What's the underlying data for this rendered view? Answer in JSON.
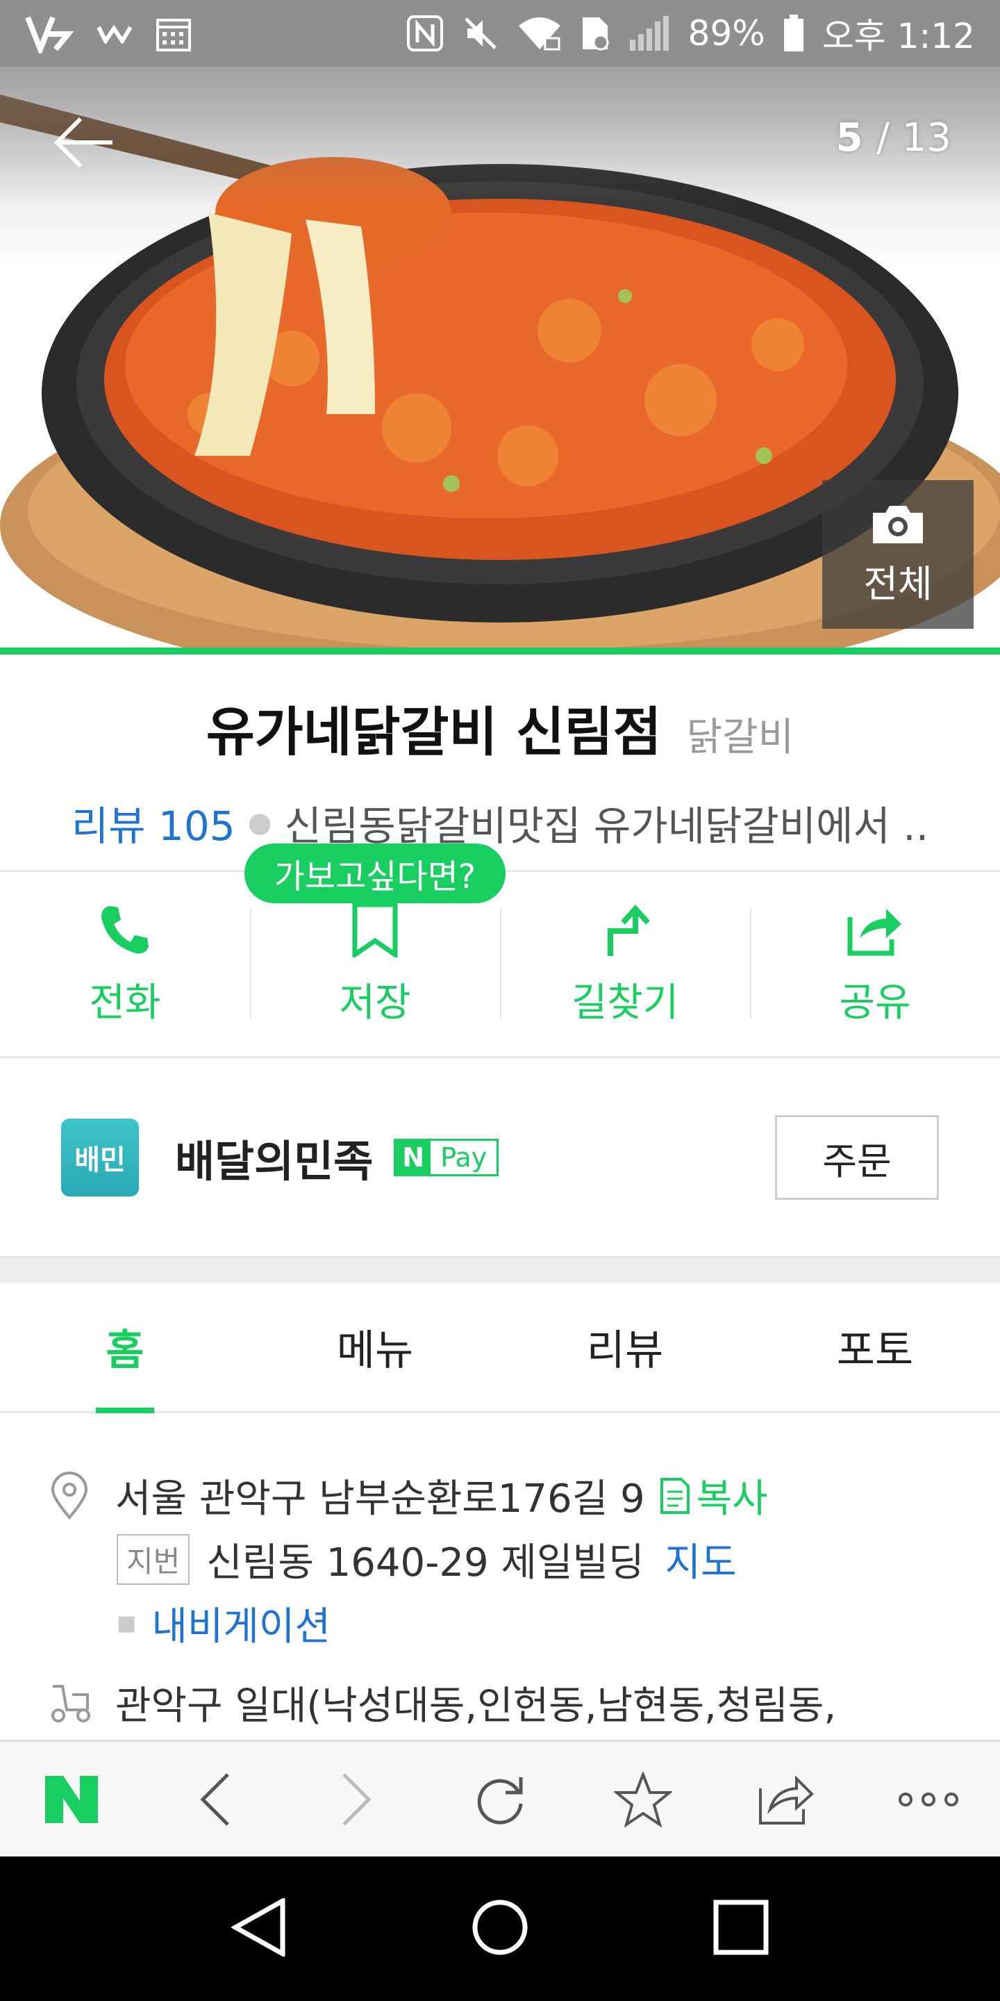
{
  "status_bar": {
    "battery": "89%",
    "time": "오후 1:12",
    "icons": [
      "v3-app-icon",
      "w-app-icon",
      "calendar-icon",
      "nfc-icon",
      "mute-icon",
      "wifi-lock-icon",
      "sim-icon",
      "signal-icon",
      "battery-icon"
    ]
  },
  "hero": {
    "current": "5",
    "total": "/ 13",
    "all_photos_label": "전체",
    "image": "steel-pan-cheese-fried-rice-photo"
  },
  "place": {
    "name": "유가네닭갈비 신림점",
    "category": "닭갈비",
    "review_label": "리뷰 105",
    "description": "신림동닭갈비맛집 유가네닭갈비에서 .."
  },
  "tooltip": "가보고싶다면?",
  "actions": [
    {
      "label": "전화",
      "icon": "phone-icon"
    },
    {
      "label": "저장",
      "icon": "bookmark-icon"
    },
    {
      "label": "길찾기",
      "icon": "directions-icon"
    },
    {
      "label": "공유",
      "icon": "share-icon"
    }
  ],
  "delivery": {
    "app_name": "배달의민족",
    "app_icon_text": "배민",
    "npay_n": "N",
    "npay_pay": "Pay",
    "order_label": "주문"
  },
  "tabs": [
    {
      "label": "홈",
      "active": true
    },
    {
      "label": "메뉴",
      "active": false
    },
    {
      "label": "리뷰",
      "active": false
    },
    {
      "label": "포토",
      "active": false
    }
  ],
  "info": {
    "address": "서울 관악구 남부순환로176길 9",
    "copy_label": "복사",
    "jibun_badge": "지번",
    "jibun_address": "신림동 1640-29 제일빌딩",
    "map_label": "지도",
    "navigation_label": "내비게이션",
    "delivery_area": "관악구 일대(낙성대동,인헌동,남현동,청림동,"
  },
  "toolbar": [
    "naver-logo",
    "back-icon",
    "forward-icon",
    "refresh-icon",
    "star-icon",
    "share-icon",
    "more-icon"
  ],
  "colors": {
    "accent": "#19ce60",
    "link": "#1f73d1"
  }
}
